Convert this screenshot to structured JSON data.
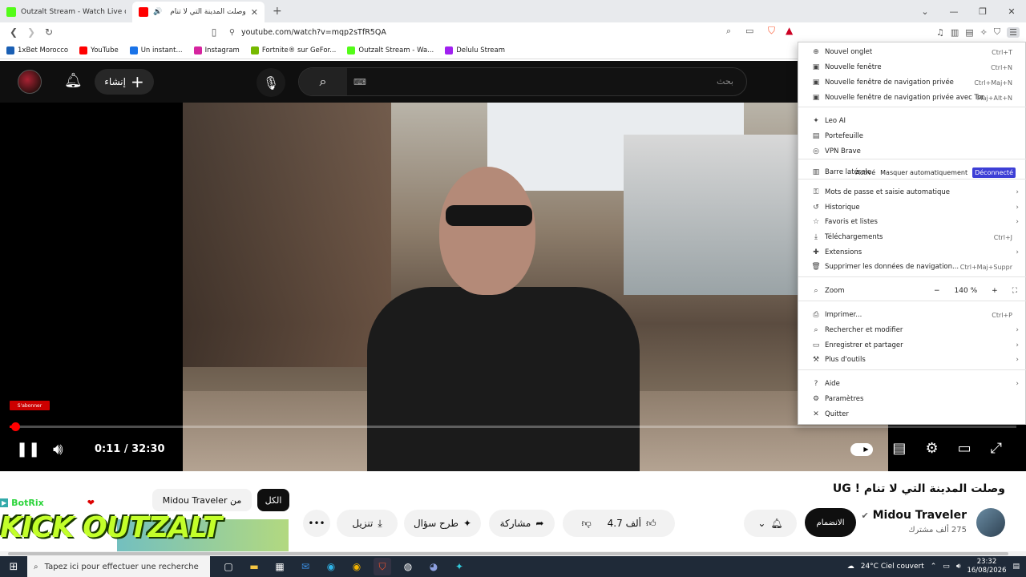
{
  "browser": {
    "tabs": [
      {
        "title": "Outzalt Stream - Watch Live on Kick",
        "color": "#53fc18"
      },
      {
        "title": "وصلت المدينة التي لا تنام ! Ug...",
        "color": "#ff0000"
      }
    ],
    "url": "youtube.com/watch?v=mqp2sTfR5QA",
    "bookmarks": [
      {
        "label": "1xBet Morocco",
        "color": "#1a5fb4"
      },
      {
        "label": "YouTube",
        "color": "#ff0000"
      },
      {
        "label": "Un instant...",
        "color": "#1a73e8"
      },
      {
        "label": "Instagram",
        "color": "#d6249f"
      },
      {
        "label": "Fortnite® sur GeFor...",
        "color": "#76b900"
      },
      {
        "label": "Outzalt Stream - Wa...",
        "color": "#53fc18"
      },
      {
        "label": "Delulu Stream",
        "color": "#a020f0"
      }
    ]
  },
  "youtube": {
    "create_label": "إنشاء",
    "search_placeholder": "بحث",
    "video": {
      "subscribe_badge": "S'abonner",
      "current_time": "0:11",
      "duration": "32:30",
      "time_display": "0:11 / 32:30",
      "progress_fraction": 0.0056
    },
    "title": "وصلت المدينة التي لا تنام ! UG",
    "channel": {
      "name": "Midou Traveler",
      "subscribers": "275 ألف مشترك"
    },
    "join_label": "الانضمام",
    "like_count": "4.7 ألف",
    "share_label": "مشاركة",
    "ask_label": "طرح سؤال",
    "download_label": "تنزيل",
    "chips": [
      "الكل",
      "Midou Traveler من"
    ]
  },
  "overlay": {
    "bot_name": "BotRix",
    "logo_text": "KICK OUTZALT"
  },
  "menu": {
    "items": [
      {
        "label": "Nouvel onglet",
        "shortcut": "Ctrl+T",
        "icon": "⊕"
      },
      {
        "label": "Nouvelle fenêtre",
        "shortcut": "Ctrl+N",
        "icon": "▣"
      },
      {
        "label": "Nouvelle fenêtre de navigation privée",
        "shortcut": "Ctrl+Maj+N",
        "icon": "▣"
      },
      {
        "label": "Nouvelle fenêtre de navigation privée avec Tor",
        "shortcut": "Maj+Alt+N",
        "icon": "▣"
      },
      {
        "label": "Leo AI",
        "shortcut": "",
        "icon": "✦"
      },
      {
        "label": "Portefeuille",
        "shortcut": "",
        "icon": "▤"
      },
      {
        "label": "VPN Brave",
        "shortcut": "",
        "icon": "◎"
      },
      {
        "label": "Barre latérale",
        "shortcut": "",
        "icon": "▥"
      },
      {
        "label": "Mots de passe et saisie automatique",
        "shortcut": "",
        "icon": "⚿"
      },
      {
        "label": "Historique",
        "shortcut": "",
        "icon": "↺"
      },
      {
        "label": "Favoris et listes",
        "shortcut": "",
        "icon": "☆"
      },
      {
        "label": "Téléchargements",
        "shortcut": "Ctrl+J",
        "icon": "⤓"
      },
      {
        "label": "Extensions",
        "shortcut": "",
        "icon": "✚"
      },
      {
        "label": "Supprimer les données de navigation...",
        "shortcut": "Ctrl+Maj+Suppr",
        "icon": "🗑"
      },
      {
        "label": "Zoom",
        "shortcut": "",
        "icon": "⌕"
      },
      {
        "label": "Imprimer...",
        "shortcut": "Ctrl+P",
        "icon": "⎙"
      },
      {
        "label": "Rechercher et modifier",
        "shortcut": "",
        "icon": "⌕"
      },
      {
        "label": "Enregistrer et partager",
        "shortcut": "",
        "icon": "▭"
      },
      {
        "label": "Plus d'outils",
        "shortcut": "",
        "icon": "⚒"
      },
      {
        "label": "Aide",
        "shortcut": "",
        "icon": "?"
      },
      {
        "label": "Paramètres",
        "shortcut": "",
        "icon": "⚙"
      },
      {
        "label": "Quitter",
        "shortcut": "",
        "icon": "✕"
      }
    ],
    "sidebar_options": [
      "Activé",
      "Masquer automatiquement",
      "Déconnecté"
    ],
    "zoom_level": "140 %"
  },
  "taskbar": {
    "search_placeholder": "Tapez ici pour effectuer une recherche",
    "weather": "24°C Ciel couvert",
    "time": "23:32",
    "date": "16/08/2026"
  }
}
